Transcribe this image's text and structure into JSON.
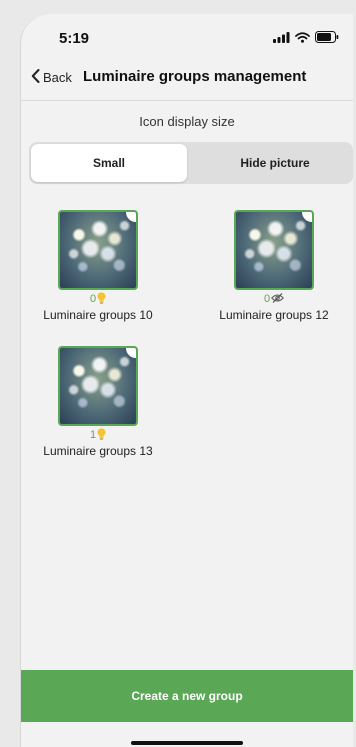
{
  "status_bar": {
    "time": "5:19"
  },
  "nav": {
    "back_label": "Back",
    "title": "Luminaire groups management"
  },
  "display_size": {
    "label": "Icon display size",
    "options": [
      "Small",
      "Hide picture"
    ],
    "selected": "Small"
  },
  "groups": [
    {
      "name": "Luminaire groups 10",
      "count": "0",
      "status_icon": "lightbulb-icon"
    },
    {
      "name": "Luminaire groups 12",
      "count": "0",
      "status_icon": "eye-off-icon"
    },
    {
      "name": "Luminaire groups 13",
      "count": "1",
      "status_icon": "lightbulb-icon"
    }
  ],
  "footer": {
    "create_label": "Create a new group"
  },
  "colors": {
    "accent": "#5aa755",
    "bulb": "#f4c430",
    "background": "#f2f2f2"
  }
}
